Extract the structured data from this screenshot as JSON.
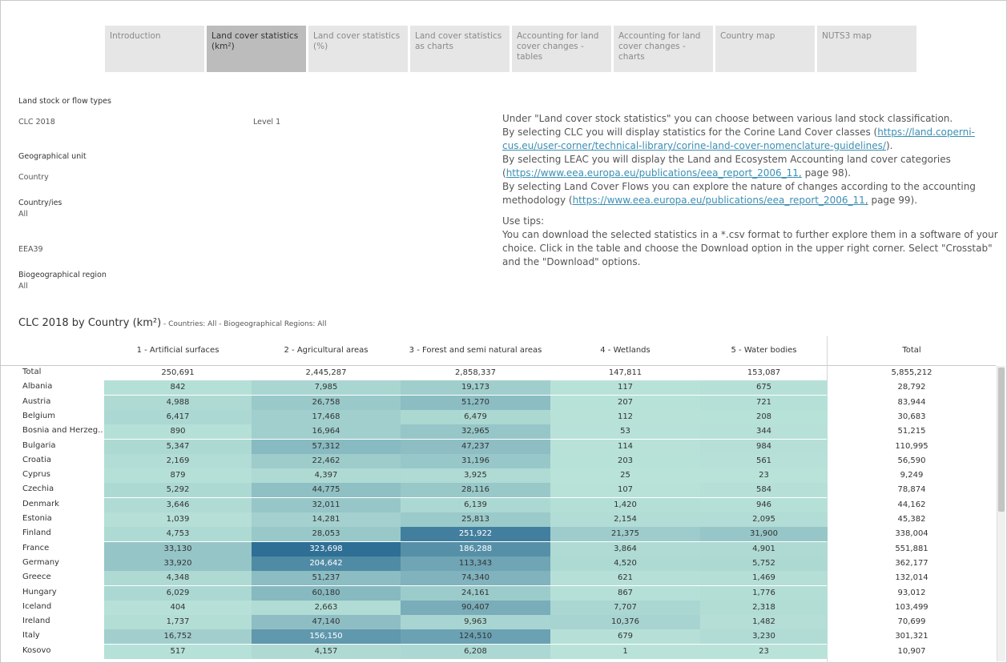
{
  "tabs": [
    {
      "label": "Introduction"
    },
    {
      "label": "Land cover statistics (km²)"
    },
    {
      "label": "Land cover statistics (%)"
    },
    {
      "label": "Land cover statistics as charts"
    },
    {
      "label": "Accounting for land cover changes - tables"
    },
    {
      "label": "Accounting for land cover changes - charts"
    },
    {
      "label": "Country map"
    },
    {
      "label": "NUTS3 map"
    }
  ],
  "filters": {
    "stock_label": "Land stock or flow types",
    "stock_value": "CLC 2018",
    "level_value": "Level 1",
    "geo_label": "Geographical unit",
    "geo_value": "Country",
    "countries_label": "Country/ies",
    "countries_value": "All",
    "group_value": "EEA39",
    "bio_label": "Biogeographical region",
    "bio_value": "All"
  },
  "info": {
    "p1a": "Under \"Land cover stock statistics\" you can choose between various land stock classification.",
    "p2a": "By selecting CLC you will display statistics for the Corine Land Cover classes (",
    "link1": "https://land.coperni-cus.eu/user-corner/technical-library/corine-land-cover-nomenclature-guidelines/",
    "p2b": ").",
    "p3a": "By selecting LEAC you will display the Land and Ecosystem Accounting land cover categories (",
    "link2": "https://www.eea.europa.eu/publications/eea_report_2006_11,",
    "p3b": " page 98).",
    "p4a": "By selecting Land Cover Flows you can explore the nature of changes according to the accounting methodology (",
    "link3": "https://www.eea.europa.eu/publications/eea_report_2006_11,",
    "p4b": " page 99).",
    "tips_title": "Use tips:",
    "tips_body": "You can download the selected statistics in a *.csv format to further explore them in a software of your choice. Click in the table and choose the Download option in the upper right corner. Select \"Crosstab\" and the \"Download\" options."
  },
  "table_title": "CLC 2018 by Country (km²)",
  "table_subtitle": " - Countries: All - Biogeographical Regions: All",
  "columns": [
    "1 - Artificial surfaces",
    "2 - Agricultural areas",
    "3 - Forest and semi natural areas",
    "4 - Wetlands",
    "5 - Water bodies",
    "Total"
  ],
  "total_row": {
    "name": "Total",
    "values": [
      "250,691",
      "2,445,287",
      "2,858,337",
      "147,811",
      "153,087"
    ],
    "total": "5,855,212"
  },
  "rows": [
    {
      "name": "Albania",
      "values": [
        "842",
        "7,985",
        "19,173",
        "117",
        "675"
      ],
      "total": "28,792"
    },
    {
      "name": "Austria",
      "values": [
        "4,988",
        "26,758",
        "51,270",
        "207",
        "721"
      ],
      "total": "83,944"
    },
    {
      "name": "Belgium",
      "values": [
        "6,417",
        "17,468",
        "6,479",
        "112",
        "208"
      ],
      "total": "30,683"
    },
    {
      "name": "Bosnia and Herzeg..",
      "values": [
        "890",
        "16,964",
        "32,965",
        "53",
        "344"
      ],
      "total": "51,215"
    },
    {
      "name": "Bulgaria",
      "values": [
        "5,347",
        "57,312",
        "47,237",
        "114",
        "984"
      ],
      "total": "110,995"
    },
    {
      "name": "Croatia",
      "values": [
        "2,169",
        "22,462",
        "31,196",
        "203",
        "561"
      ],
      "total": "56,590"
    },
    {
      "name": "Cyprus",
      "values": [
        "879",
        "4,397",
        "3,925",
        "25",
        "23"
      ],
      "total": "9,249"
    },
    {
      "name": "Czechia",
      "values": [
        "5,292",
        "44,775",
        "28,116",
        "107",
        "584"
      ],
      "total": "78,874"
    },
    {
      "name": "Denmark",
      "values": [
        "3,646",
        "32,011",
        "6,139",
        "1,420",
        "946"
      ],
      "total": "44,162"
    },
    {
      "name": "Estonia",
      "values": [
        "1,039",
        "14,281",
        "25,813",
        "2,154",
        "2,095"
      ],
      "total": "45,382"
    },
    {
      "name": "Finland",
      "values": [
        "4,753",
        "28,053",
        "251,922",
        "21,375",
        "31,900"
      ],
      "total": "338,004"
    },
    {
      "name": "France",
      "values": [
        "33,130",
        "323,698",
        "186,288",
        "3,864",
        "4,901"
      ],
      "total": "551,881"
    },
    {
      "name": "Germany",
      "values": [
        "33,920",
        "204,642",
        "113,343",
        "4,520",
        "5,752"
      ],
      "total": "362,177"
    },
    {
      "name": "Greece",
      "values": [
        "4,348",
        "51,237",
        "74,340",
        "621",
        "1,469"
      ],
      "total": "132,014"
    },
    {
      "name": "Hungary",
      "values": [
        "6,029",
        "60,180",
        "24,161",
        "867",
        "1,776"
      ],
      "total": "93,012"
    },
    {
      "name": "Iceland",
      "values": [
        "404",
        "2,663",
        "90,407",
        "7,707",
        "2,318"
      ],
      "total": "103,499"
    },
    {
      "name": "Ireland",
      "values": [
        "1,737",
        "47,140",
        "9,963",
        "10,376",
        "1,482"
      ],
      "total": "70,699"
    },
    {
      "name": "Italy",
      "values": [
        "16,752",
        "156,150",
        "124,510",
        "679",
        "3,230"
      ],
      "total": "301,321"
    },
    {
      "name": "Kosovo",
      "values": [
        "517",
        "4,157",
        "6,208",
        "1",
        "23"
      ],
      "total": "10,907"
    }
  ],
  "colors": {
    "low": "#b9e3d9",
    "high": "#2f6f95",
    "tab_active": "#bcbcbc",
    "tab": "#e6e6e6",
    "link": "#3b8fb4"
  }
}
